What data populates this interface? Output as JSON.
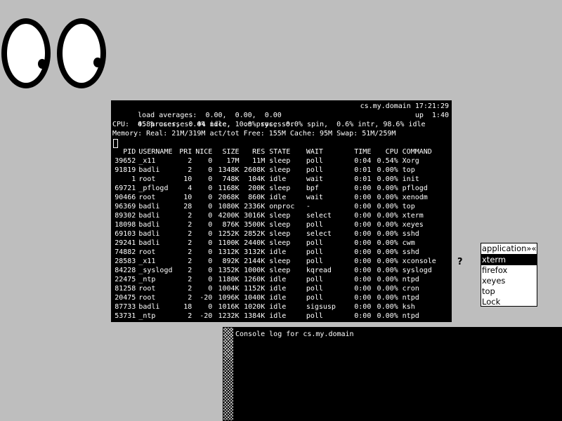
{
  "top": {
    "load": "load averages:  0.00,  0.00,  0.00",
    "host_time": "cs.my.domain 17:21:29",
    "processes": "45 processes: 44 idle, 1 on processor",
    "uptime": "up  1:40",
    "cpu": "CPU:  0.8% user,  0.0% nice,  0.0% sys,  0.0% spin,  0.6% intr, 98.6% idle",
    "memory": "Memory: Real: 21M/319M act/tot Free: 155M Cache: 95M Swap: 51M/259M",
    "columns": [
      "PID",
      "USERNAME",
      "PRI",
      "NICE",
      "SIZE",
      "RES",
      "STATE",
      "WAIT",
      "TIME",
      "CPU",
      "COMMAND"
    ],
    "rows": [
      [
        "39652",
        "_x11",
        "2",
        "0",
        "17M",
        "11M",
        "sleep",
        "poll",
        "0:04",
        "0.54%",
        "Xorg"
      ],
      [
        "91819",
        "badli",
        "2",
        "0",
        "1348K",
        "2608K",
        "sleep",
        "poll",
        "0:01",
        "0.00%",
        "top"
      ],
      [
        "1",
        "root",
        "10",
        "0",
        "748K",
        "104K",
        "idle",
        "wait",
        "0:01",
        "0.00%",
        "init"
      ],
      [
        "69721",
        "_pflogd",
        "4",
        "0",
        "1168K",
        "200K",
        "sleep",
        "bpf",
        "0:00",
        "0.00%",
        "pflogd"
      ],
      [
        "90466",
        "root",
        "10",
        "0",
        "2068K",
        "860K",
        "idle",
        "wait",
        "0:00",
        "0.00%",
        "xenodm"
      ],
      [
        "96369",
        "badli",
        "28",
        "0",
        "1080K",
        "2336K",
        "onproc",
        "-",
        "0:00",
        "0.00%",
        "top"
      ],
      [
        "89302",
        "badli",
        "2",
        "0",
        "4200K",
        "3016K",
        "sleep",
        "select",
        "0:00",
        "0.00%",
        "xterm"
      ],
      [
        "18098",
        "badli",
        "2",
        "0",
        "876K",
        "3500K",
        "sleep",
        "poll",
        "0:00",
        "0.00%",
        "xeyes"
      ],
      [
        "69103",
        "badli",
        "2",
        "0",
        "1252K",
        "2852K",
        "sleep",
        "select",
        "0:00",
        "0.00%",
        "sshd"
      ],
      [
        "29241",
        "badli",
        "2",
        "0",
        "1100K",
        "2440K",
        "sleep",
        "poll",
        "0:00",
        "0.00%",
        "cwm"
      ],
      [
        "74882",
        "root",
        "2",
        "0",
        "1312K",
        "3132K",
        "idle",
        "poll",
        "0:00",
        "0.00%",
        "sshd"
      ],
      [
        "28583",
        "_x11",
        "2",
        "0",
        "892K",
        "2144K",
        "sleep",
        "poll",
        "0:00",
        "0.00%",
        "xconsole"
      ],
      [
        "84228",
        "_syslogd",
        "2",
        "0",
        "1352K",
        "1000K",
        "sleep",
        "kqread",
        "0:00",
        "0.00%",
        "syslogd"
      ],
      [
        "22475",
        "_ntp",
        "2",
        "0",
        "1180K",
        "1260K",
        "idle",
        "poll",
        "0:00",
        "0.00%",
        "ntpd"
      ],
      [
        "81258",
        "root",
        "2",
        "0",
        "1004K",
        "1152K",
        "idle",
        "poll",
        "0:00",
        "0.00%",
        "cron"
      ],
      [
        "20475",
        "root",
        "2",
        "-20",
        "1096K",
        "1040K",
        "idle",
        "poll",
        "0:00",
        "0.00%",
        "ntpd"
      ],
      [
        "87733",
        "badli",
        "18",
        "0",
        "1016K",
        "1020K",
        "idle",
        "sigsusp",
        "0:00",
        "0.00%",
        "ksh"
      ],
      [
        "53731",
        "_ntp",
        "2",
        "-20",
        "1232K",
        "1384K",
        "idle",
        "poll",
        "0:00",
        "0.00%",
        "ntpd"
      ]
    ]
  },
  "console": {
    "text": "Console log for cs.my.domain"
  },
  "menu": {
    "title": "application»«",
    "items": [
      "xterm",
      "firefox",
      "xeyes",
      "top",
      "Lock"
    ],
    "selected": "xterm"
  },
  "cursor_glyph": "?",
  "colors": {
    "desktop": "#bebebe",
    "terminal_bg": "#000000",
    "terminal_fg": "#ffffff"
  }
}
